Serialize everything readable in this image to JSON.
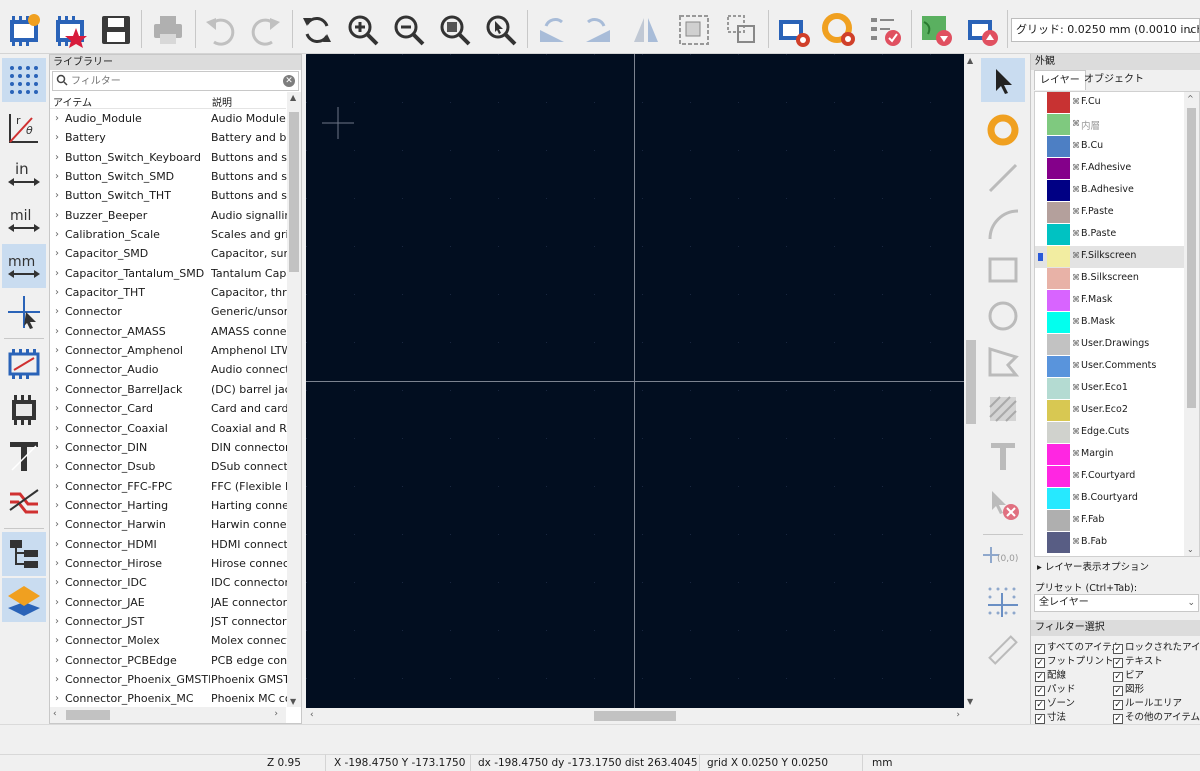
{
  "toolbar": {
    "grid_select": "グリッド: 0.0250 mm (0.0010 inch)"
  },
  "library": {
    "title": "ライブラリー",
    "filter_placeholder": "フィルター",
    "col_item": "アイテム",
    "col_desc": "説明",
    "rows": [
      {
        "name": "Audio_Module",
        "desc": "Audio Module footprints"
      },
      {
        "name": "Battery",
        "desc": "Battery and battery holders"
      },
      {
        "name": "Button_Switch_Keyboard",
        "desc": "Buttons and switches"
      },
      {
        "name": "Button_Switch_SMD",
        "desc": "Buttons and switches"
      },
      {
        "name": "Button_Switch_THT",
        "desc": "Buttons and switches"
      },
      {
        "name": "Buzzer_Beeper",
        "desc": "Audio signalling devices"
      },
      {
        "name": "Calibration_Scale",
        "desc": "Scales and grids"
      },
      {
        "name": "Capacitor_SMD",
        "desc": "Capacitor, surface mount"
      },
      {
        "name": "Capacitor_Tantalum_SMD",
        "desc": "Tantalum Capacitor"
      },
      {
        "name": "Capacitor_THT",
        "desc": "Capacitor, through hole"
      },
      {
        "name": "Connector",
        "desc": "Generic/unsorted connectors"
      },
      {
        "name": "Connector_AMASS",
        "desc": "AMASS connectors"
      },
      {
        "name": "Connector_Amphenol",
        "desc": "Amphenol LTW connectors"
      },
      {
        "name": "Connector_Audio",
        "desc": "Audio connectors"
      },
      {
        "name": "Connector_BarrelJack",
        "desc": "(DC) barrel jack connectors"
      },
      {
        "name": "Connector_Card",
        "desc": "Card and card holders"
      },
      {
        "name": "Connector_Coaxial",
        "desc": "Coaxial and RF connectors"
      },
      {
        "name": "Connector_DIN",
        "desc": "DIN connector footprints"
      },
      {
        "name": "Connector_Dsub",
        "desc": "DSub connectors"
      },
      {
        "name": "Connector_FFC-FPC",
        "desc": "FFC (Flexible Flat Cable)"
      },
      {
        "name": "Connector_Harting",
        "desc": "Harting connectors"
      },
      {
        "name": "Connector_Harwin",
        "desc": "Harwin connectors"
      },
      {
        "name": "Connector_HDMI",
        "desc": "HDMI connectors"
      },
      {
        "name": "Connector_Hirose",
        "desc": "Hirose connectors"
      },
      {
        "name": "Connector_IDC",
        "desc": "IDC connector footprints"
      },
      {
        "name": "Connector_JAE",
        "desc": "JAE connector footprints"
      },
      {
        "name": "Connector_JST",
        "desc": "JST connector footprints"
      },
      {
        "name": "Connector_Molex",
        "desc": "Molex connectors"
      },
      {
        "name": "Connector_PCBEdge",
        "desc": "PCB edge connectors"
      },
      {
        "name": "Connector_Phoenix_GMSTB",
        "desc": "Phoenix GMSTB connectors"
      },
      {
        "name": "Connector_Phoenix_MC",
        "desc": "Phoenix MC connectors"
      }
    ]
  },
  "appearance": {
    "title": "外観",
    "tab_layers": "レイヤー",
    "tab_objects": "オブジェクト",
    "layers": [
      {
        "name": "F.Cu",
        "color": "#c83232"
      },
      {
        "name": "内層",
        "color": "#7fc97f",
        "dim": true
      },
      {
        "name": "B.Cu",
        "color": "#4d7fc4"
      },
      {
        "name": "F.Adhesive",
        "color": "#84008a"
      },
      {
        "name": "B.Adhesive",
        "color": "#000084"
      },
      {
        "name": "F.Paste",
        "color": "#b4a09c"
      },
      {
        "name": "B.Paste",
        "color": "#00c2c2"
      },
      {
        "name": "F.Silkscreen",
        "color": "#f2eda1",
        "selected": true
      },
      {
        "name": "B.Silkscreen",
        "color": "#e8b2a7"
      },
      {
        "name": "F.Mask",
        "color": "#d864ff"
      },
      {
        "name": "B.Mask",
        "color": "#02ffee"
      },
      {
        "name": "User.Drawings",
        "color": "#c2c2c2"
      },
      {
        "name": "User.Comments",
        "color": "#5994dc"
      },
      {
        "name": "User.Eco1",
        "color": "#b4dbd2"
      },
      {
        "name": "User.Eco2",
        "color": "#d8c852"
      },
      {
        "name": "Edge.Cuts",
        "color": "#d0d2cd"
      },
      {
        "name": "Margin",
        "color": "#ff26e2"
      },
      {
        "name": "F.Courtyard",
        "color": "#ff26e2"
      },
      {
        "name": "B.Courtyard",
        "color": "#26e9ff"
      },
      {
        "name": "F.Fab",
        "color": "#afafaf"
      },
      {
        "name": "B.Fab",
        "color": "#585d84"
      }
    ],
    "layer_options": "レイヤー表示オプション",
    "preset_label": "プリセット (Ctrl+Tab):",
    "preset_value": "全レイヤー"
  },
  "filter": {
    "title": "フィルター選択",
    "items": [
      "すべてのアイテム",
      "ロックされたアイテム",
      "フットプリント",
      "テキスト",
      "配線",
      "ビア",
      "パッド",
      "図形",
      "ゾーン",
      "ルールエリア",
      "寸法",
      "その他のアイテム"
    ]
  },
  "status": {
    "zoom": "Z 0.95",
    "xy": "X -198.4750  Y -173.1750",
    "delta": "dx -198.4750  dy -173.1750  dist 263.4045",
    "grid": "grid X 0.0250  Y 0.0250",
    "units": "mm"
  },
  "accent_color": "#c9dcf0",
  "canvas_color": "#020e20"
}
